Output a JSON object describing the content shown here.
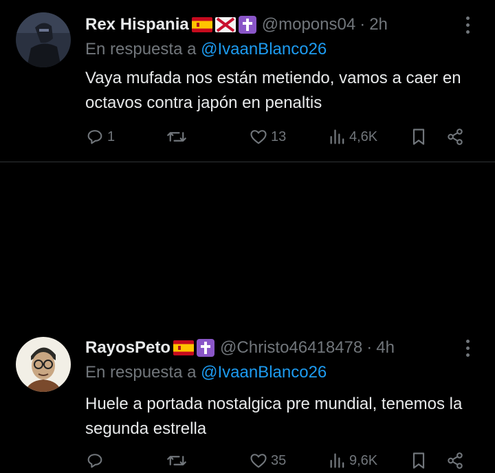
{
  "tweets": [
    {
      "display_name": "Rex Hispania",
      "handle": "@mopons04",
      "separator": "·",
      "time": "2h",
      "reply_prefix": "En respuesta a",
      "reply_mention": "@IvaanBlanco26",
      "text": "Vaya mufada nos están metiendo, vamos a caer en octavos contra japón en penaltis",
      "replies": "1",
      "retweets": "",
      "likes": "13",
      "views": "4,6K",
      "badges": [
        "spain-flag",
        "burgundy-cross-flag",
        "cross-emoji"
      ]
    },
    {
      "display_name": "RayosPeto",
      "handle": "@Christo46418478",
      "separator": "·",
      "time": "4h",
      "reply_prefix": "En respuesta a",
      "reply_mention": "@IvaanBlanco26",
      "text": "Huele a portada nostalgica pre mundial, tenemos la segunda estrella",
      "replies": "",
      "retweets": "",
      "likes": "35",
      "views": "9,6K",
      "badges": [
        "spain-flag",
        "cross-emoji"
      ]
    }
  ],
  "colors": {
    "background": "#000000",
    "text": "#e7e9ea",
    "muted": "#71767b",
    "link": "#1d9bf0",
    "divider": "#2f3336"
  }
}
